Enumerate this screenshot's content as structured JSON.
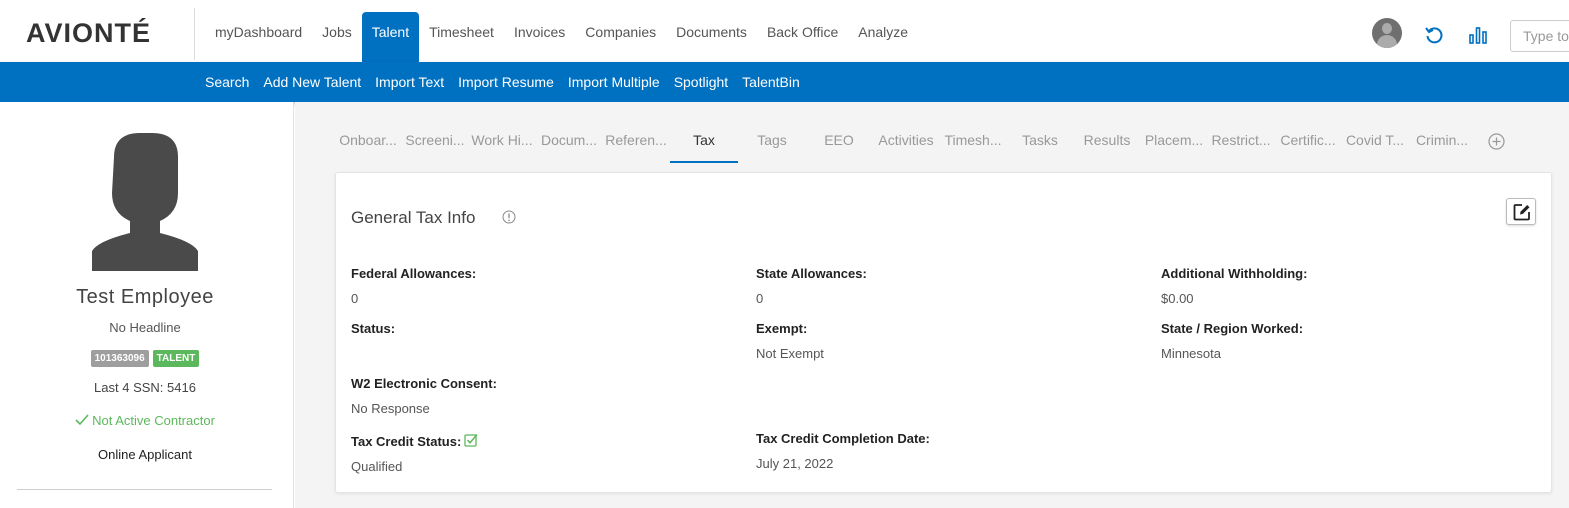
{
  "app": {
    "logo": "AVIONTÉ"
  },
  "main_nav": [
    {
      "label": "myDashboard",
      "active": false
    },
    {
      "label": "Jobs",
      "active": false
    },
    {
      "label": "Talent",
      "active": true
    },
    {
      "label": "Timesheet",
      "active": false
    },
    {
      "label": "Invoices",
      "active": false
    },
    {
      "label": "Companies",
      "active": false
    },
    {
      "label": "Documents",
      "active": false
    },
    {
      "label": "Back Office",
      "active": false
    },
    {
      "label": "Analyze",
      "active": false
    }
  ],
  "header": {
    "search_placeholder": "Type to search",
    "icons": [
      "user-avatar-icon",
      "refresh-icon",
      "analytics-chart-icon"
    ]
  },
  "sub_nav": [
    "Search",
    "Add New Talent",
    "Import Text",
    "Import Resume",
    "Import Multiple",
    "Spotlight",
    "TalentBin"
  ],
  "profile": {
    "name": "Test Employee",
    "headline": "No Headline",
    "id_badge": "101363096",
    "type_badge": "TALENT",
    "ssn": "Last 4 SSN: 5416",
    "contractor_status": "Not Active Contractor",
    "source": "Online Applicant"
  },
  "tabs": [
    {
      "label": "Onboar...",
      "active": false
    },
    {
      "label": "Screeni...",
      "active": false
    },
    {
      "label": "Work Hi...",
      "active": false
    },
    {
      "label": "Docum...",
      "active": false
    },
    {
      "label": "Referen...",
      "active": false
    },
    {
      "label": "Tax",
      "active": true
    },
    {
      "label": "Tags",
      "active": false
    },
    {
      "label": "EEO",
      "active": false
    },
    {
      "label": "Activities",
      "active": false
    },
    {
      "label": "Timesh...",
      "active": false
    },
    {
      "label": "Tasks",
      "active": false
    },
    {
      "label": "Results",
      "active": false
    },
    {
      "label": "Placem...",
      "active": false
    },
    {
      "label": "Restrict...",
      "active": false
    },
    {
      "label": "Certific...",
      "active": false
    },
    {
      "label": "Covid T...",
      "active": false
    },
    {
      "label": "Crimin...",
      "active": false
    }
  ],
  "tax": {
    "title": "General Tax Info",
    "federal_allowances_label": "Federal Allowances:",
    "federal_allowances": "0",
    "state_allowances_label": "State Allowances:",
    "state_allowances": "0",
    "additional_withholding_label": "Additional Withholding:",
    "additional_withholding": "$0.00",
    "status_label": "Status:",
    "status": "",
    "exempt_label": "Exempt:",
    "exempt": "Not Exempt",
    "state_region_label": "State / Region Worked:",
    "state_region": "Minnesota",
    "w2_consent_label": "W2 Electronic Consent:",
    "w2_consent": "No Response",
    "tax_credit_status_label": "Tax Credit Status:",
    "tax_credit_status": "Qualified",
    "tax_credit_completion_label": "Tax Credit Completion Date:",
    "tax_credit_completion": "July 21, 2022"
  },
  "colors": {
    "brand_blue": "#0070c0",
    "success_green": "#5cb85c",
    "badge_gray": "#9e9e9e"
  }
}
